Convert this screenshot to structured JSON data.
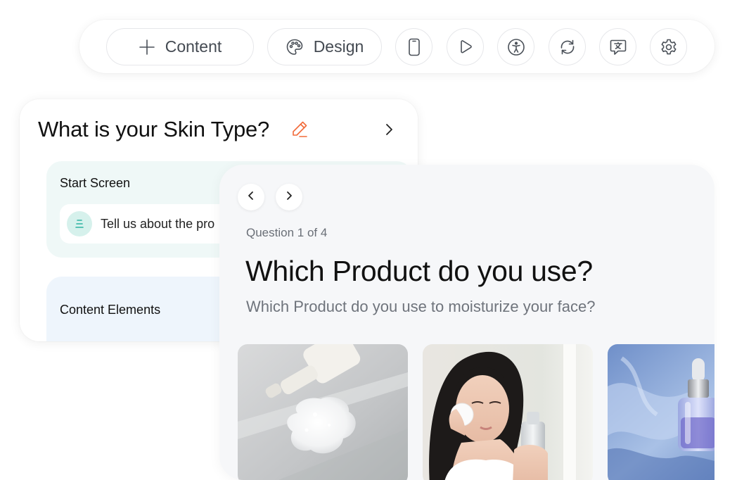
{
  "toolbar": {
    "content_label": "Content",
    "design_label": "Design",
    "icons": [
      "plus-icon",
      "palette-icon",
      "mobile-icon",
      "play-icon",
      "accessibility-icon",
      "refresh-icon",
      "translate-icon",
      "gear-icon"
    ]
  },
  "editor": {
    "title": "What is your Skin Type?",
    "start_screen": {
      "label": "Start Screen",
      "item_text": "Tell us about the pro"
    },
    "content_elements": {
      "label": "Content Elements"
    }
  },
  "preview": {
    "question_counter": "Question 1 of 4",
    "question_title": "Which Product do you use?",
    "question_subtitle": "Which Product do you use to moisturize your face?",
    "options": [
      {
        "image": "cleansing-foam-photo"
      },
      {
        "image": "woman-with-toner-photo"
      },
      {
        "image": "serum-bottle-photo"
      }
    ]
  },
  "colors": {
    "accent_orange": "#f26b3a",
    "teal_icon": "#2bb3a0",
    "start_card_bg": "#eff8f7",
    "content_card_bg": "#eef5fc",
    "preview_bg": "#f6f7f9"
  }
}
